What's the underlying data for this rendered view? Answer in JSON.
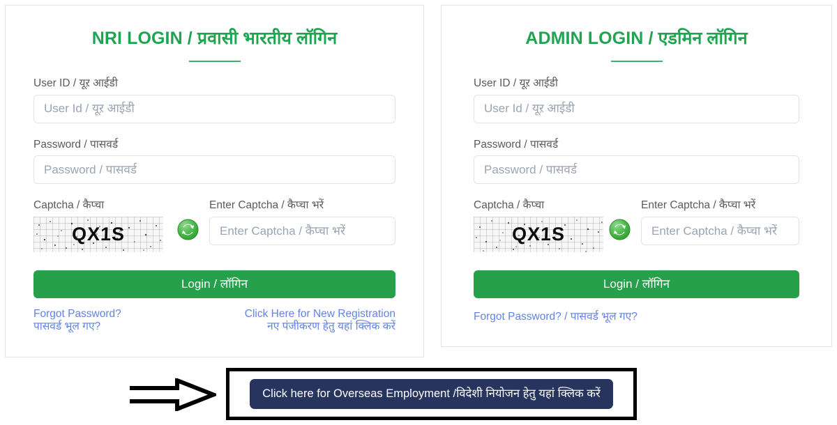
{
  "nri_panel": {
    "title": "NRI LOGIN / प्रवासी भारतीय लॉगिन",
    "user_id_label": "User ID / यूऱ आईडी",
    "user_id_value": "",
    "user_id_placeholder": "User Id / यूऱ आईडी",
    "password_label": "Password / पासवर्ड",
    "password_value": "",
    "password_placeholder": "Password / पासवर्ड",
    "captcha_label": "Captcha / कैप्चा",
    "captcha_text": "QX1S",
    "refresh_icon": "refresh-icon",
    "enter_captcha_label": "Enter Captcha / कैप्चा भरें",
    "enter_captcha_value": "",
    "enter_captcha_placeholder": "Enter Captcha / कैप्चा भरें",
    "login_label": "Login / लॉगिन",
    "forgot_line1": "Forgot Password?",
    "forgot_line2": "पासवर्ड भूल गए?",
    "register_line1": "Click Here for New Registration",
    "register_line2": "नए पंजीकरण हेतु यहां क्लिक करें"
  },
  "admin_panel": {
    "title": "ADMIN LOGIN / एडमिन लॉगिन",
    "user_id_label": "User ID / यूऱ आईडी",
    "user_id_value": "",
    "user_id_placeholder": "User Id / यूऱ आईडी",
    "password_label": "Password / पासवर्ड",
    "password_value": "",
    "password_placeholder": "Password / पासवर्ड",
    "captcha_label": "Captcha / कैप्चा",
    "captcha_text": "QX1S",
    "refresh_icon": "refresh-icon",
    "enter_captcha_label": "Enter Captcha / कैप्चा भरें",
    "enter_captcha_value": "",
    "enter_captcha_placeholder": "Enter Captcha / कैप्चा भरें",
    "login_label": "Login / लॉगिन",
    "forgot_label": "Forgot Password? / पासवर्ड भूल गए?"
  },
  "cta": {
    "button_label": "Click here for Overseas Employment /विदेशी नियोजन हेतु यहां क्लिक करें",
    "arrow_icon": "arrow-right-icon"
  },
  "colors": {
    "title_green": "#1ea551",
    "button_green": "#27a04c",
    "link_blue": "#6183e4",
    "cta_navy": "#27355e",
    "card_border": "#e3e3e3",
    "highlight_black": "#000000"
  }
}
